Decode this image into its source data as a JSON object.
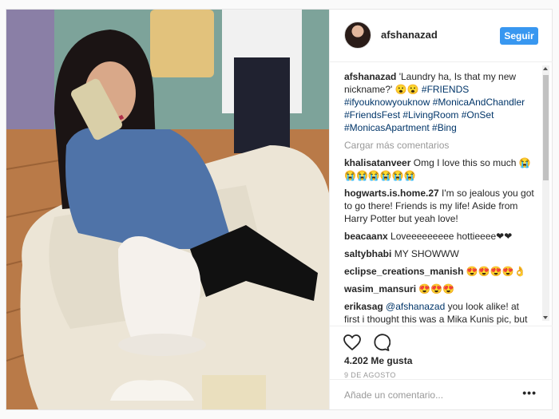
{
  "post": {
    "username": "afshanazad",
    "follow_label": "Seguir",
    "load_more": "Cargar más comentarios",
    "likes": "4.202 Me gusta",
    "date": "9 DE AGOSTO",
    "add_comment_placeholder": "Añade un comentario...",
    "more_glyph": "•••"
  },
  "caption": {
    "user": "afshanazad",
    "text": "'Laundry ha, Is that my new nickname?' 😮😮",
    "tags": "#FRIENDS #ifyouknowyouknow #MonicaAndChandler #FriendsFest #LivingRoom #OnSet #MonicasApartment #Bing"
  },
  "comments": [
    {
      "user": "khalisatanveer",
      "text": "Omg I love this so much 😭😭😭😭😭😭😭"
    },
    {
      "user": "hogwarts.is.home.27",
      "text": "I'm so jealous you got to go there! Friends is my life! Aside from Harry Potter but yeah love!"
    },
    {
      "user": "beacaanx",
      "text": "Loveeeeeeeee hottieeee❤❤"
    },
    {
      "user": "saltybhabi",
      "text": "MY SHOWWW"
    },
    {
      "user": "eclipse_creations_manish",
      "text": "😍😍😍😍👌"
    },
    {
      "user": "wasim_mansuri",
      "text": "😍😍😍"
    },
    {
      "user": "erikasag",
      "mention": "@afshanazad",
      "text": "you look alike! at first i thought this was a Mika Kunis pic, but then I saw that it was you! 🙀"
    }
  ],
  "colors": {
    "accent": "#3897f0",
    "hashtag": "#003569",
    "muted": "#999999"
  },
  "icons": {
    "like": "heart-icon",
    "comment": "comment-bubble-icon",
    "more": "more-options-icon"
  }
}
